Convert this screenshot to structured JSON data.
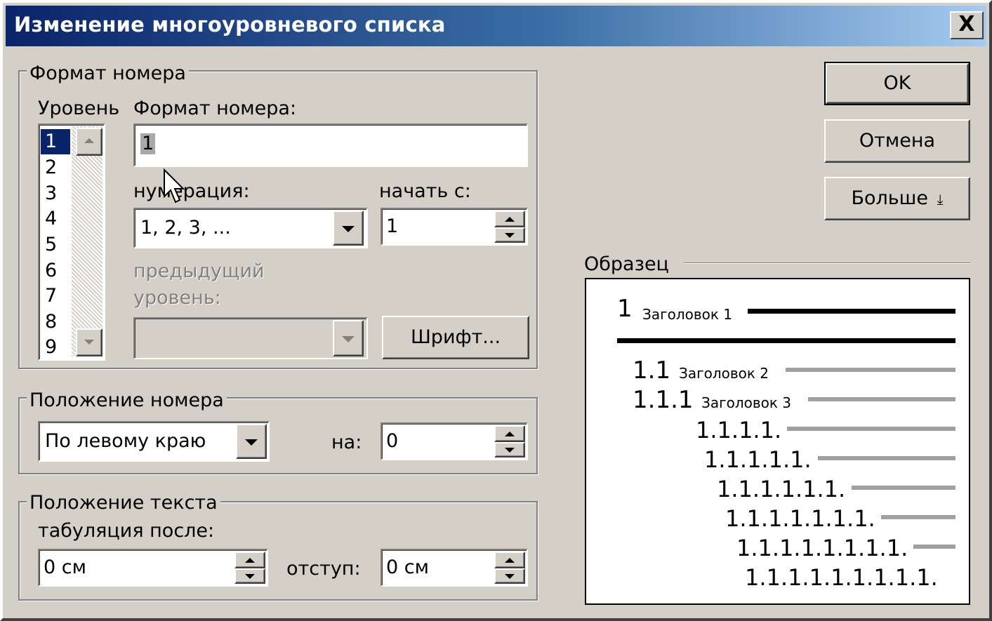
{
  "window": {
    "title": "Изменение многоуровневого списка",
    "close_glyph": "X"
  },
  "number_format": {
    "group_label": "Формат номера",
    "level_label": "Уровень",
    "levels": [
      "1",
      "2",
      "3",
      "4",
      "5",
      "6",
      "7",
      "8",
      "9"
    ],
    "selected_level": "1",
    "format_label": "Формат номера:",
    "format_value": "1",
    "numbering_label": "нумерация:",
    "numbering_value": "1, 2, 3, ...",
    "start_label": "начать с:",
    "start_value": "1",
    "prev_level_label_1": "предыдущий",
    "prev_level_label_2": "уровень:",
    "font_button": "Шрифт..."
  },
  "number_position": {
    "group_label": "Положение номера",
    "alignment_value": "По левому краю",
    "at_label": "на:",
    "at_value": "0"
  },
  "text_position": {
    "group_label": "Положение текста",
    "tab_label": "табуляция после:",
    "tab_value": "0 см",
    "indent_label": "отступ:",
    "indent_value": "0 см"
  },
  "buttons": {
    "ok": "OK",
    "cancel": "Отмена",
    "more": "Больше",
    "more_glyph": "  ⤓"
  },
  "preview": {
    "label": "Образец",
    "rows": [
      {
        "number": "1",
        "caption": "Заголовок 1"
      },
      {
        "number": "1.1",
        "caption": "Заголовок 2"
      },
      {
        "number": "1.1.1",
        "caption": "Заголовок 3"
      },
      {
        "number": "1.1.1.1.",
        "caption": ""
      },
      {
        "number": "1.1.1.1.1.",
        "caption": ""
      },
      {
        "number": "1.1.1.1.1.1.",
        "caption": ""
      },
      {
        "number": "1.1.1.1.1.1.1.",
        "caption": ""
      },
      {
        "number": "1.1.1.1.1.1.1.1.",
        "caption": ""
      },
      {
        "number": "1.1.1.1.1.1.1.1.1.",
        "caption": ""
      }
    ]
  },
  "colors": {
    "face": "#d4d0c8",
    "title_start": "#0a246a",
    "title_end": "#a6caf0",
    "selection": "#0a246a"
  }
}
